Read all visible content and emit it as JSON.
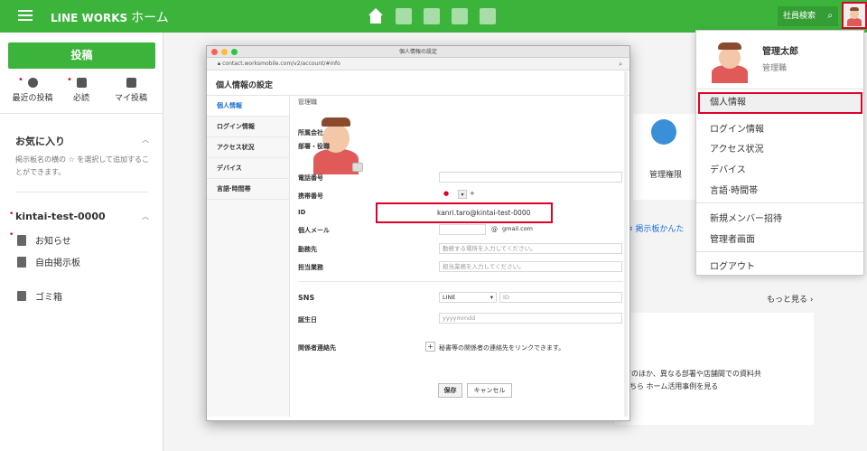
{
  "topbar": {
    "brand": "LINE WORKS",
    "home": "ホーム",
    "emp_search": "社員検索",
    "nav_icons": [
      "home-icon",
      "chat-icon",
      "calendar-icon",
      "contacts-icon",
      "drive-icon"
    ],
    "accent": "#3cb43c"
  },
  "sidebar": {
    "post_button": "投稿",
    "quick": [
      {
        "label": "最近の投稿",
        "icon": "clock-icon"
      },
      {
        "label": "必読",
        "icon": "check-icon"
      },
      {
        "label": "マイ投稿",
        "icon": "my-icon"
      }
    ],
    "favorites_title": "お気に入り",
    "favorites_desc": "掲示板名の横の ☆ を選択して追加することができます。",
    "group_title": "kintai-test-0000",
    "items": [
      "お知らせ",
      "自由掲示板",
      "ゴミ箱"
    ]
  },
  "background": {
    "admin_label": "管理権限",
    "board_link": "掲示板かんた",
    "more": "もっと見る",
    "desc1": "共有のほか、異なる部署や店舗間での資料共",
    "desc2": "こちら ホーム活用事例を見る"
  },
  "dialog": {
    "window_title": "個人情報の設定",
    "url": "contact.worksmobile.com/v2/account/#info",
    "title": "個人情報の設定",
    "nav": [
      "個人情報",
      "ログイン情報",
      "アクセス状況",
      "デバイス",
      "言語·時間帯"
    ],
    "role_value": "管理職",
    "labels": {
      "company": "所属会社",
      "dept": "部署・役職",
      "phone": "電話番号",
      "mobile": "携帯番号",
      "id": "ID",
      "personal_email": "個人メール",
      "office": "勤務先",
      "duty": "担当業務",
      "sns": "SNS",
      "birthday": "誕生日",
      "related": "関係者連絡先"
    },
    "mobile_plus": "+",
    "id_value": "kanri.taro@kintai-test-0000",
    "email_domain": "gmail.com",
    "office_placeholder": "勤務する場所を入力してください。",
    "duty_placeholder": "担当業務を入力してください。",
    "sns_select": "LINE",
    "sns_id_placeholder": "ID",
    "birthday_placeholder": "yyyymmdd",
    "related_text": "秘書等の関係者の連絡先をリンクできます。",
    "save": "保存",
    "cancel": "キャンセル"
  },
  "menu": {
    "name": "管理太郎",
    "role": "管理職",
    "items": [
      "個人情報",
      "ログイン情報",
      "アクセス状況",
      "デバイス",
      "言語·時間帯",
      "新規メンバー招待",
      "管理者画面",
      "ログアウト"
    ]
  }
}
